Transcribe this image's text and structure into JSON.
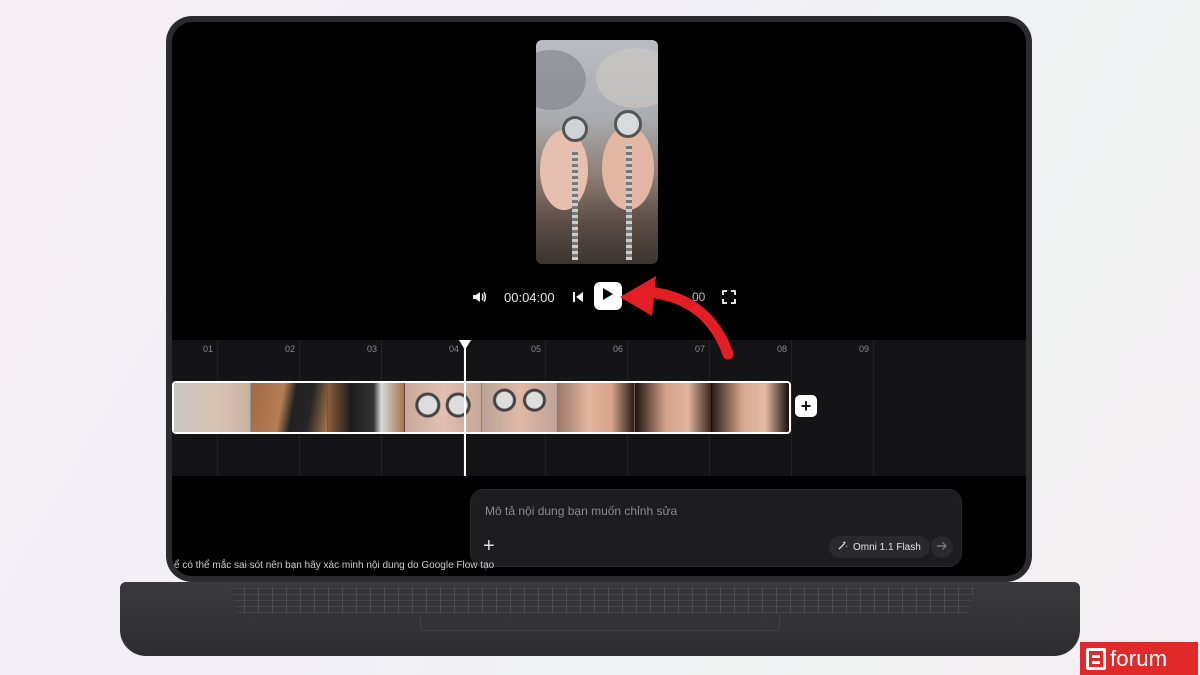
{
  "player": {
    "current_time": "00:04:00",
    "end_time_fragment": "00"
  },
  "timeline": {
    "ticks": [
      "01",
      "02",
      "03",
      "04",
      "05",
      "06",
      "07",
      "08",
      "09"
    ]
  },
  "prompt": {
    "placeholder": "Mô tả nội dung bạn muốn chỉnh sửa",
    "model": "Omni 1.1 Flash"
  },
  "disclaimer": "ể có thể mắc sai sót nên bạn hãy xác minh nội dung do Google Flow tạo",
  "watermark": {
    "text": "forum"
  },
  "colors": {
    "accent_arrow": "#e31e24",
    "watermark_bg": "#e02a2a"
  },
  "icons": [
    "volume-icon",
    "skip-back-icon",
    "play-icon",
    "fullscreen-icon",
    "plus-icon",
    "sparkle-icon",
    "arrow-right-icon"
  ]
}
